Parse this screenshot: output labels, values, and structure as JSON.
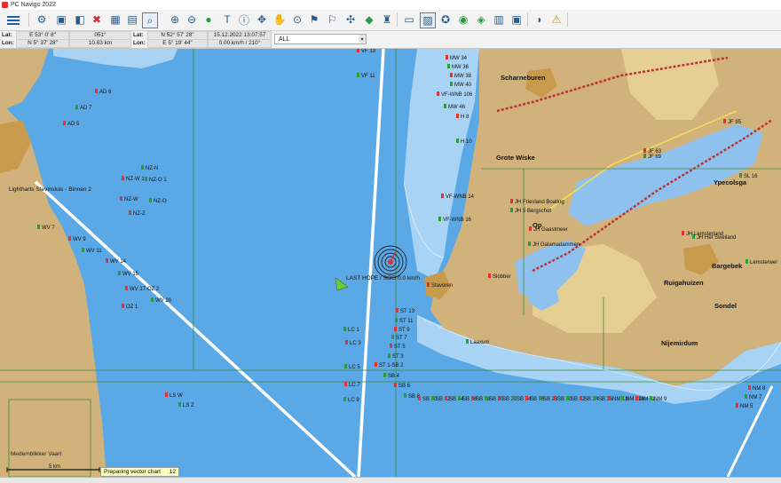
{
  "window": {
    "title": "PC Navigo 2022"
  },
  "toolbar": {
    "tools": [
      "gear-icon",
      "route-icon",
      "layers-icon",
      "delete-icon",
      "save-icon",
      "chart-icon",
      "zoom-select-icon",
      "zoom-in-icon",
      "zoom-out-icon",
      "globe-icon",
      "text-icon",
      "info-icon",
      "pan-icon",
      "hand-icon",
      "pin-icon",
      "flag-icon",
      "flags-icon",
      "satellite-icon",
      "ship-icon",
      "lighthouse-icon",
      "monitor-icon",
      "monitor-off-icon",
      "compass-icon",
      "earth-icon",
      "map-icon",
      "display-icon",
      "screen-icon",
      "wave-icon",
      "warning-icon"
    ]
  },
  "infobar": {
    "cursor": {
      "lat_label": "Lat:",
      "lon_label": "Lon:",
      "lat": "E 53° 0' 8\"",
      "lon": "N 5° 37' 28\"",
      "bearing": "051°",
      "distance": "10.63 km"
    },
    "ship": {
      "lat_label": "Lat:",
      "lon_label": "Lon:",
      "lat": "N 52° 57' 28\"",
      "lon": "E 5° 19' 44\"",
      "time": "15.12.2022 13:07:57",
      "speed": "0.00 km/h / 210°"
    },
    "filter": "ALL"
  },
  "map": {
    "colors": {
      "water": "#5aa8e6",
      "shallow": "#a9d3f5",
      "land": "#d1b27a",
      "polder": "#e6cf92",
      "urban": "#c79a4c",
      "lake": "#8fc1ef",
      "fairway": "#ffffff",
      "grid": "#3b8a3b"
    },
    "places": [
      "Scharneburen",
      "Grote Wiske",
      "Op",
      "Ypecolsga",
      "Bargebek",
      "Ruigahuizen",
      "Sondel",
      "Nijemirdum"
    ],
    "vessel_label": "LAST HOPE / SOG 0.0 km/h",
    "lock_label": "Lightharts Stevinsluis - Binnen 2",
    "canal_label": "Medemblikker Vaart",
    "scale_label": "5 km",
    "buoys_kornwerderzand": [
      "VF 13",
      "VF 11",
      "MW 34",
      "MW 36",
      "MW 38",
      "MW 40",
      "VF-WNB 106",
      "MW 46",
      "H 8",
      "H 10",
      "VF-WNB 14",
      "VF-WNB 16",
      "AD 6",
      "AD 7",
      "AD 5",
      "NZ-N",
      "NZ-W 1",
      "NZ-O 1",
      "NZ-W",
      "NZ-O",
      "NZ-Z",
      "WV 7",
      "WV 9",
      "WV 11",
      "WV 14",
      "WV 15",
      "WV 17-OZ 2",
      "WV 20",
      "OZ 1",
      "LC 1",
      "LC 3",
      "LC 5",
      "LC 7",
      "LC 9",
      "LS W",
      "LS Z",
      "JF 63",
      "JF 69",
      "JF 95",
      "SL 16"
    ],
    "fairway_buoys": [
      "ST 13",
      "ST 11",
      "ST 9",
      "ST 7",
      "ST 5",
      "ST 3",
      "ST 1-SB 2",
      "SB 4",
      "SB 6",
      "SB 8",
      "SB 10",
      "SB 12",
      "SB 14",
      "SB 16",
      "SB 18",
      "SB 20",
      "SB 22",
      "SB 24",
      "SB 26",
      "SB 28",
      "SB 30",
      "SB 32",
      "SB 34",
      "SB 36",
      "NM 13",
      "NM 11A",
      "NM 11",
      "NM 9",
      "NM 8",
      "NM 7",
      "NM 5"
    ],
    "local_labels": [
      "JH Friesland Boating",
      "JH 5 Bergschot",
      "JH Gaastmeer",
      "JH Galamadammen",
      "Slobber",
      "JH Het Sweiland",
      "JH Lemsterland",
      "Lemsterwel",
      "Stavoren",
      "Laaxum"
    ]
  },
  "status": {
    "notice": "Preparing vector chart",
    "count": "12"
  }
}
